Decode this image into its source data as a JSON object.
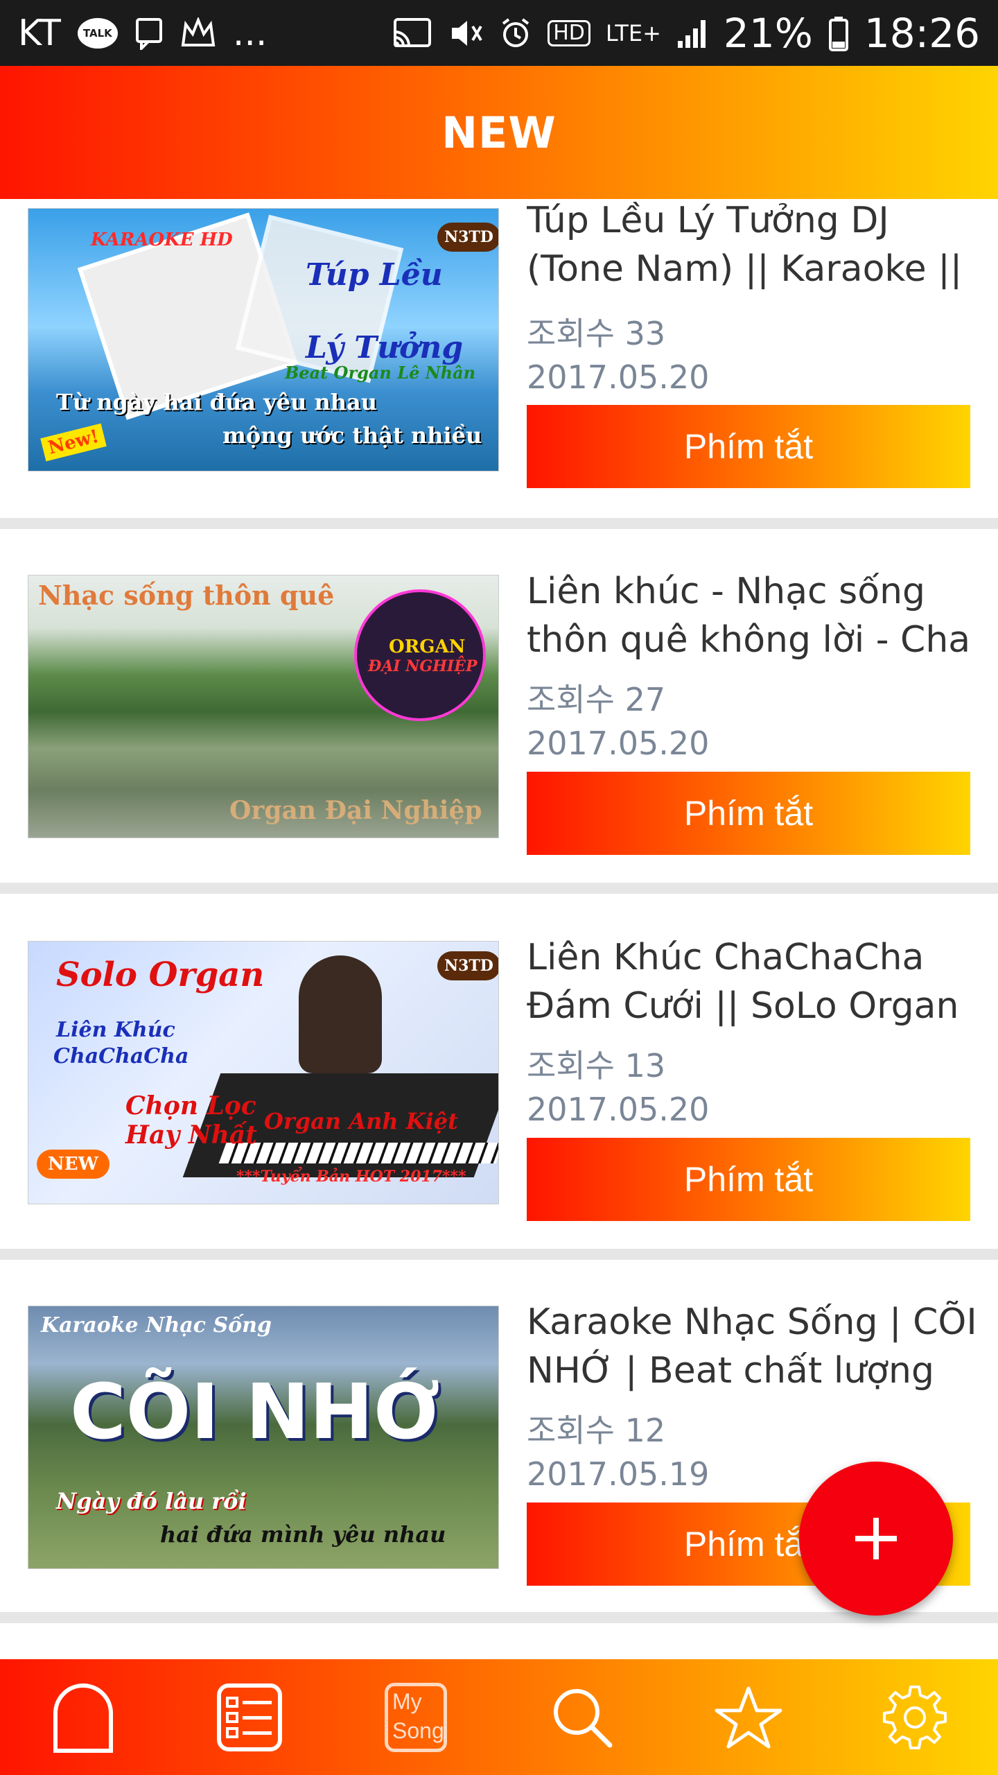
{
  "status_bar": {
    "carrier": "KT",
    "talk_badge": "TALK",
    "more": "...",
    "hd_badge": "HD",
    "network": "LTE+",
    "battery": "21%",
    "time": "18:26"
  },
  "header": {
    "title": "NEW"
  },
  "items": [
    {
      "title": "Túp Lều Lý Tưởng DJ (Tone Nam) || Karaoke ||",
      "views": "조회수 33",
      "date": "2017.05.20",
      "button": "Phím tắt",
      "thumb": {
        "top_label": "KARAOKE HD",
        "title_line1": "Túp Lều",
        "title_line2": "Lý Tưởng",
        "subtitle": "Beat Organ Lê Nhân",
        "lyric1": "Từ ngày hai đứa yêu nhau",
        "lyric2": "mộng ước thật nhiều",
        "badge": "New!",
        "logo": "N3TD"
      }
    },
    {
      "title": "Liên khúc - Nhạc sống thôn quê không lời - Cha",
      "views": "조회수 27",
      "date": "2017.05.20",
      "button": "Phím tắt",
      "thumb": {
        "top_label": "Nhạc sống thôn quê",
        "logo_line1": "ORGAN",
        "logo_line2": "ĐẠI NGHIỆP",
        "bottom_label": "Organ Đại Nghiệp"
      }
    },
    {
      "title": "Liên Khúc ChaChaCha Đám Cưới || SoLo Organ ||",
      "views": "조회수 13",
      "date": "2017.05.20",
      "button": "Phím tắt",
      "thumb": {
        "title": "Solo Organ",
        "sub1": "Liên Khúc",
        "sub2": "ChaChaCha",
        "pick1": "Chọn Lọc",
        "pick2": "Hay Nhất",
        "artist": "Organ Anh Kiệt",
        "badge": "NEW",
        "footer": "***Tuyển Bản HOT 2017***",
        "logo": "N3TD"
      }
    },
    {
      "title": "Karaoke Nhạc Sống | CÕI NHỚ | Beat chất lượng cao",
      "views": "조회수 12",
      "date": "2017.05.19",
      "button": "Phím tắt",
      "thumb": {
        "top_label": "Karaoke Nhạc Sống",
        "big_title": "CÕI NHỚ",
        "lyric1": "Ngày đó lâu rồi",
        "lyric2": "hai đứa mình yêu nhau"
      }
    }
  ],
  "fab": {
    "icon": "plus-icon"
  },
  "bottom_nav": {
    "items": [
      {
        "icon": "home-arch-icon"
      },
      {
        "icon": "list-icon"
      },
      {
        "icon": "mysong-icon",
        "label_my": "My",
        "label_song": "Song"
      },
      {
        "icon": "search-icon"
      },
      {
        "icon": "star-icon"
      },
      {
        "icon": "gear-icon"
      }
    ]
  },
  "colors": {
    "gradient_start": "#ff1500",
    "gradient_mid": "#ff7a00",
    "gradient_end": "#ffd400",
    "fab": "#f5000f",
    "meta_text": "#7a8696"
  }
}
